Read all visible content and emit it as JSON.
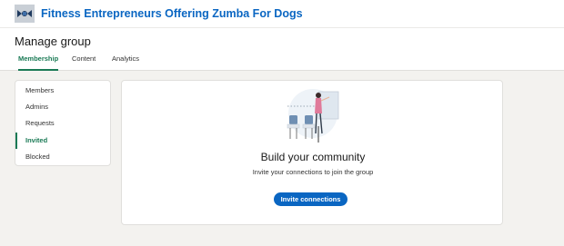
{
  "group": {
    "name": "Fitness Entrepreneurs Offering Zumba For Dogs",
    "logo_icon": "group-logo-icon"
  },
  "page": {
    "title": "Manage group"
  },
  "tabs": [
    {
      "label": "Membership",
      "active": true
    },
    {
      "label": "Content",
      "active": false
    },
    {
      "label": "Analytics",
      "active": false
    }
  ],
  "sidebar": {
    "items": [
      {
        "label": "Members",
        "active": false
      },
      {
        "label": "Admins",
        "active": false
      },
      {
        "label": "Requests",
        "active": false
      },
      {
        "label": "Invited",
        "active": true
      },
      {
        "label": "Blocked",
        "active": false
      }
    ]
  },
  "empty_state": {
    "title": "Build your community",
    "subtitle": "Invite your connections to join the group",
    "button_label": "Invite connections",
    "illustration": "community-illustration"
  },
  "colors": {
    "accent_green": "#1a7a55",
    "link_blue": "#0a66c2",
    "background": "#f3f2ef"
  }
}
